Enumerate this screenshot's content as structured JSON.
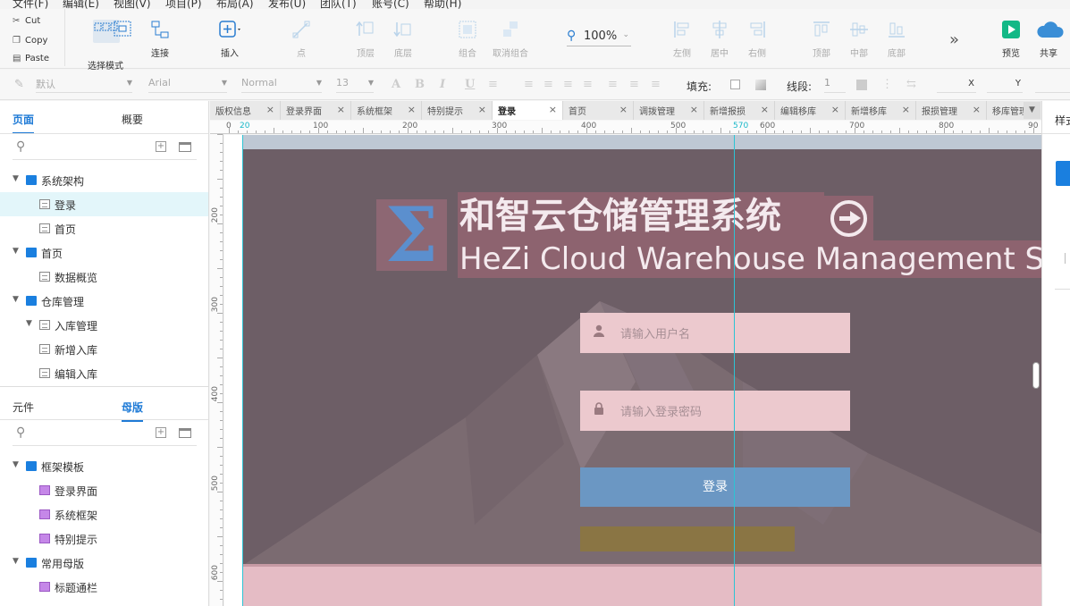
{
  "menubar": [
    "文件(F)",
    "编辑(E)",
    "视图(V)",
    "项目(P)",
    "布局(A)",
    "发布(U)",
    "团队(T)",
    "账号(C)",
    "帮助(H)"
  ],
  "clipboard": {
    "cut": "Cut",
    "copy": "Copy",
    "paste": "Paste"
  },
  "toolbar": {
    "select_mode": "选择模式",
    "connect": "连接",
    "insert": "插入",
    "point": "点",
    "top_layer": "顶层",
    "bottom_layer": "底层",
    "group": "组合",
    "ungroup": "取消组合",
    "zoom": "100%",
    "left": "左侧",
    "center": "居中",
    "right": "右侧",
    "top": "顶部",
    "middle": "中部",
    "bottom": "底部",
    "preview": "预览",
    "share": "共享"
  },
  "format": {
    "style": "默认",
    "font": "Arial",
    "weight": "Normal",
    "size": "13",
    "fill_label": "填充:",
    "line_label": "线段:",
    "line_value": "1",
    "x_label": "X",
    "y_label": "Y"
  },
  "left_panel": {
    "tab_pages": "页面",
    "tab_outline": "概要",
    "pages": [
      {
        "label": "系统架构",
        "type": "folder",
        "level": 0,
        "expanded": true
      },
      {
        "label": "登录",
        "type": "page",
        "level": 1,
        "selected": true
      },
      {
        "label": "首页",
        "type": "page",
        "level": 1
      },
      {
        "label": "首页",
        "type": "folder",
        "level": 0,
        "expanded": true
      },
      {
        "label": "数据概览",
        "type": "page",
        "level": 1
      },
      {
        "label": "仓库管理",
        "type": "folder",
        "level": 0,
        "expanded": true
      },
      {
        "label": "入库管理",
        "type": "page",
        "level": 1,
        "expanded": true
      },
      {
        "label": "新增入库",
        "type": "page",
        "level": 2
      },
      {
        "label": "编辑入库",
        "type": "page",
        "level": 2
      }
    ],
    "tab_widgets": "元件",
    "tab_masters": "母版",
    "masters": [
      {
        "label": "框架模板",
        "type": "folder",
        "level": 0
      },
      {
        "label": "登录界面",
        "type": "master",
        "level": 1
      },
      {
        "label": "系统框架",
        "type": "master",
        "level": 1
      },
      {
        "label": "特别提示",
        "type": "master",
        "level": 1
      },
      {
        "label": "常用母版",
        "type": "folder",
        "level": 0
      },
      {
        "label": "标题通栏",
        "type": "master",
        "level": 1
      }
    ]
  },
  "tabs": [
    "版权信息",
    "登录界面",
    "系统框架",
    "特别提示",
    "登录",
    "首页",
    "调拨管理",
    "新增报损",
    "编辑移库",
    "新增移库",
    "报损管理",
    "移库管理"
  ],
  "active_tab": "登录",
  "ruler": {
    "h": [
      "0",
      "20",
      "100",
      "200",
      "300",
      "400",
      "500",
      "570",
      "600",
      "700",
      "800",
      "90"
    ],
    "v": [
      "200",
      "300",
      "400",
      "500",
      "600"
    ]
  },
  "login": {
    "logo": "Σ",
    "title_cn": "和智云仓储管理系统",
    "title_en": "HeZi Cloud Warehouse Management System",
    "username_placeholder": "请输入用户名",
    "password_placeholder": "请输入登录密码",
    "login_button": "登录"
  },
  "right_panel": {
    "tab": "样式"
  }
}
